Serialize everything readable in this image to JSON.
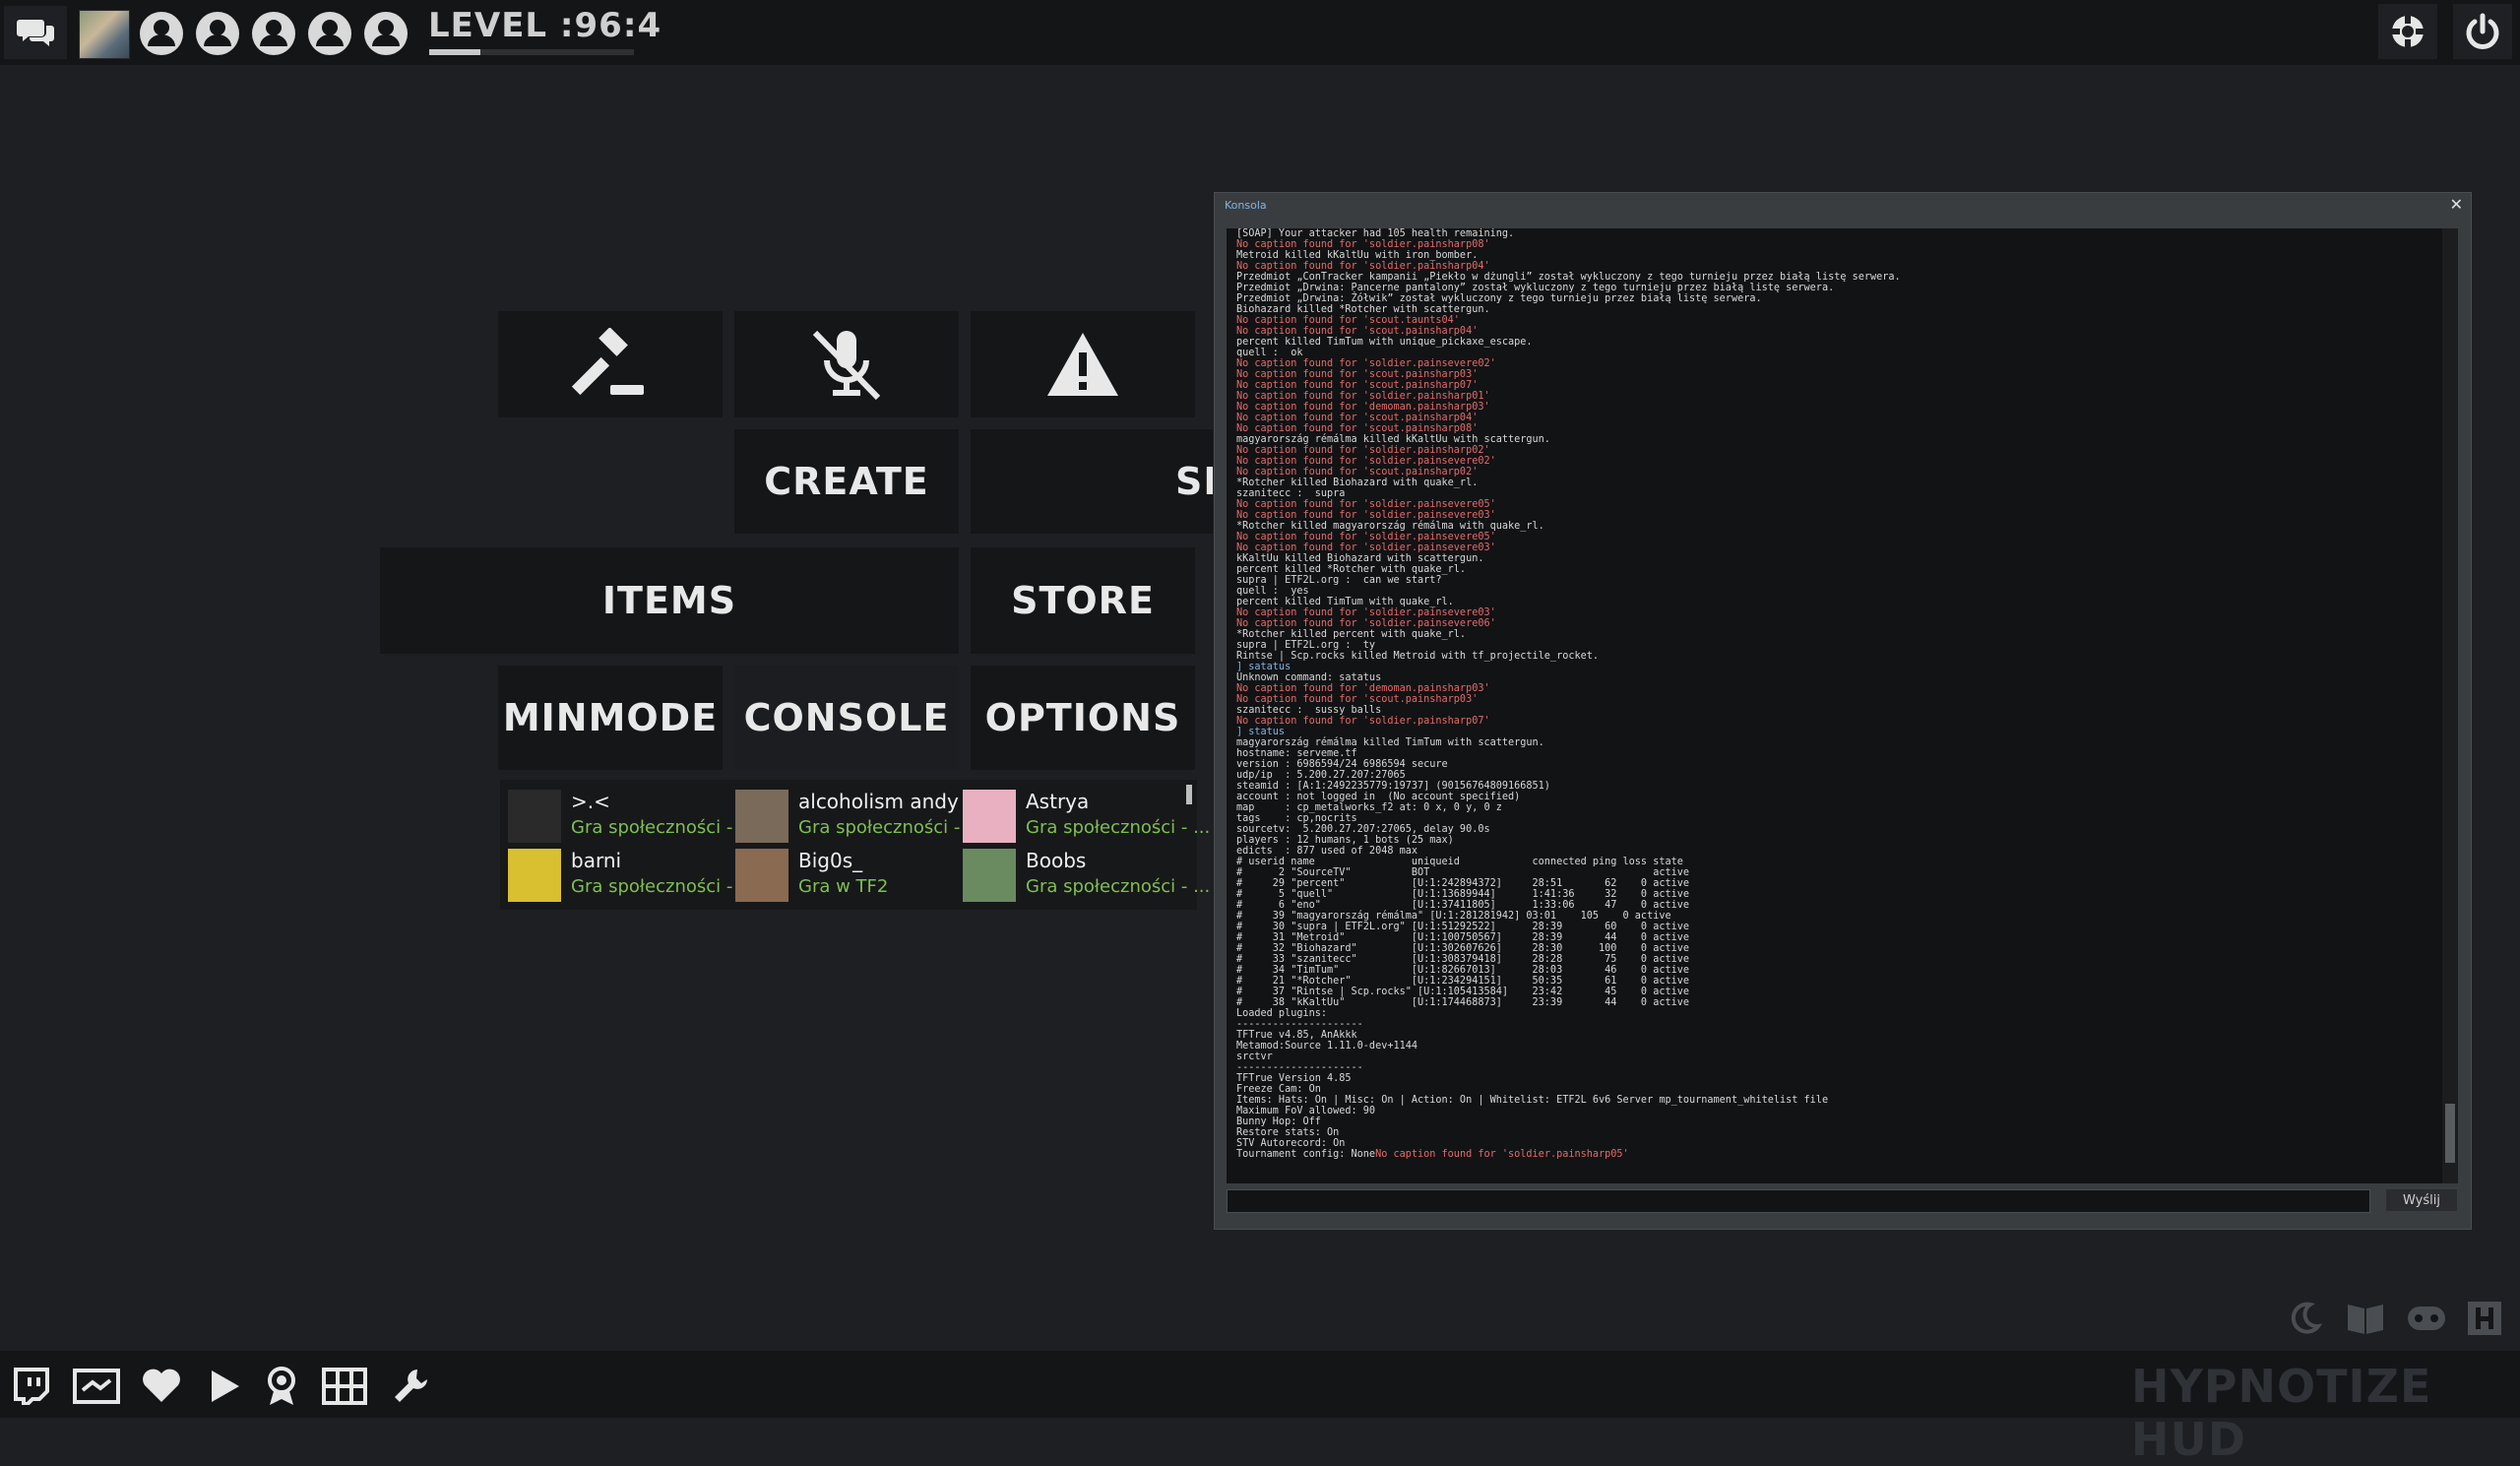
{
  "header": {
    "level_text": "LEVEL :96:4",
    "level_progress": 0.25,
    "party_slots": 5
  },
  "menu": {
    "create": "CREATE",
    "server_partial": "SE",
    "items": "ITEMS",
    "store": "STORE",
    "minmode": "MINMODE",
    "console": "CONSOLE",
    "options": "OPTIONS"
  },
  "friends": [
    {
      "name": ">.<",
      "status": "Gra społeczności - ...",
      "color": "#2a2a2a"
    },
    {
      "name": "alcoholism andy",
      "status": "Gra społeczności - ...",
      "color": "#7a6a5a"
    },
    {
      "name": "Astrya",
      "status": "Gra społeczności - ...",
      "color": "#e8b0c0"
    },
    {
      "name": "barni",
      "status": "Gra społeczności - ...",
      "color": "#d8c030"
    },
    {
      "name": "Big0s_",
      "status": "Gra w TF2",
      "color": "#8a6a50"
    },
    {
      "name": "Boobs",
      "status": "Gra społeczności - ...",
      "color": "#6a8a60"
    }
  ],
  "console": {
    "title": "Konsola",
    "send_label": "Wyślij",
    "lines": [
      {
        "t": "[SOAP] Your attacker had 105 health remaining.",
        "c": ""
      },
      {
        "t": "No caption found for 'soldier.painsharp08'",
        "c": "err"
      },
      {
        "t": "Metroid killed kKaltUu with iron_bomber.",
        "c": ""
      },
      {
        "t": "No caption found for 'soldier.painsharp04'",
        "c": "err"
      },
      {
        "t": "Przedmiot „ConTracker kampanii „Piekło w dżungli” został wykluczony z tego turnieju przez białą listę serwera.",
        "c": ""
      },
      {
        "t": "Przedmiot „Drwina: Pancerne pantalony” został wykluczony z tego turnieju przez białą listę serwera.",
        "c": ""
      },
      {
        "t": "Przedmiot „Drwina: Żółwik” został wykluczony z tego turnieju przez białą listę serwera.",
        "c": ""
      },
      {
        "t": "Biohazard killed *Rotcher with scattergun.",
        "c": ""
      },
      {
        "t": "No caption found for 'scout.taunts04'",
        "c": "err"
      },
      {
        "t": "No caption found for 'scout.painsharp04'",
        "c": "err"
      },
      {
        "t": "percent killed TimTum with unique_pickaxe_escape.",
        "c": ""
      },
      {
        "t": "quell :  ok",
        "c": ""
      },
      {
        "t": "No caption found for 'soldier.painsevere02'",
        "c": "err"
      },
      {
        "t": "No caption found for 'scout.painsharp03'",
        "c": "err"
      },
      {
        "t": "No caption found for 'scout.painsharp07'",
        "c": "err"
      },
      {
        "t": "No caption found for 'soldier.painsharp01'",
        "c": "err"
      },
      {
        "t": "No caption found for 'demoman.painsharp03'",
        "c": "err"
      },
      {
        "t": "No caption found for 'scout.painsharp04'",
        "c": "err"
      },
      {
        "t": "No caption found for 'scout.painsharp08'",
        "c": "err"
      },
      {
        "t": "magyarország rémálma killed kKaltUu with scattergun.",
        "c": ""
      },
      {
        "t": "No caption found for 'soldier.painsharp02'",
        "c": "err"
      },
      {
        "t": "No caption found for 'soldier.painsevere02'",
        "c": "err"
      },
      {
        "t": "No caption found for 'scout.painsharp02'",
        "c": "err"
      },
      {
        "t": "*Rotcher killed Biohazard with quake_rl.",
        "c": ""
      },
      {
        "t": "szanitecc :  supra",
        "c": ""
      },
      {
        "t": "No caption found for 'soldier.painsevere05'",
        "c": "err"
      },
      {
        "t": "No caption found for 'soldier.painsevere03'",
        "c": "err"
      },
      {
        "t": "*Rotcher killed magyarország rémálma with quake_rl.",
        "c": ""
      },
      {
        "t": "No caption found for 'soldier.painsevere05'",
        "c": "err"
      },
      {
        "t": "No caption found for 'soldier.painsevere03'",
        "c": "err"
      },
      {
        "t": "kKaltUu killed Biohazard with scattergun.",
        "c": ""
      },
      {
        "t": "percent killed *Rotcher with quake_rl.",
        "c": ""
      },
      {
        "t": "supra | ETF2L.org :  can we start?",
        "c": ""
      },
      {
        "t": "quell :  yes",
        "c": ""
      },
      {
        "t": "percent killed TimTum with quake_rl.",
        "c": ""
      },
      {
        "t": "No caption found for 'soldier.painsevere03'",
        "c": "err"
      },
      {
        "t": "No caption found for 'soldier.painsevere06'",
        "c": "err"
      },
      {
        "t": "*Rotcher killed percent with quake_rl.",
        "c": ""
      },
      {
        "t": "supra | ETF2L.org :  ty",
        "c": ""
      },
      {
        "t": "Rintse | Scp.rocks killed Metroid with tf_projectile_rocket.",
        "c": ""
      },
      {
        "t": "] satatus",
        "c": "cmd"
      },
      {
        "t": "Unknown command: satatus",
        "c": ""
      },
      {
        "t": "No caption found for 'demoman.painsharp03'",
        "c": "err"
      },
      {
        "t": "No caption found for 'scout.painsharp03'",
        "c": "err"
      },
      {
        "t": "szanitecc :  sussy balls",
        "c": ""
      },
      {
        "t": "No caption found for 'soldier.painsharp07'",
        "c": "err"
      },
      {
        "t": "] status",
        "c": "cmd"
      },
      {
        "t": "magyarország rémálma killed TimTum with scattergun.",
        "c": ""
      },
      {
        "t": "hostname: serveme.tf",
        "c": ""
      },
      {
        "t": "version : 6986594/24 6986594 secure",
        "c": ""
      },
      {
        "t": "udp/ip  : 5.200.27.207:27065",
        "c": ""
      },
      {
        "t": "steamid : [A:1:2492235779:19737] (90156764809166851)",
        "c": ""
      },
      {
        "t": "account : not logged in  (No account specified)",
        "c": ""
      },
      {
        "t": "map     : cp_metalworks_f2 at: 0 x, 0 y, 0 z",
        "c": ""
      },
      {
        "t": "tags    : cp,nocrits",
        "c": ""
      },
      {
        "t": "sourcetv:  5.200.27.207:27065, delay 90.0s",
        "c": ""
      },
      {
        "t": "players : 12 humans, 1 bots (25 max)",
        "c": ""
      },
      {
        "t": "edicts  : 877 used of 2048 max",
        "c": ""
      },
      {
        "t": "# userid name                uniqueid            connected ping loss state",
        "c": ""
      },
      {
        "t": "#      2 \"SourceTV\"          BOT                                     active",
        "c": ""
      },
      {
        "t": "#     29 \"percent\"           [U:1:242894372]     28:51       62    0 active",
        "c": ""
      },
      {
        "t": "#      5 \"quell\"             [U:1:13689944]      1:41:36     32    0 active",
        "c": ""
      },
      {
        "t": "#      6 \"eno\"               [U:1:37411805]      1:33:06     47    0 active",
        "c": ""
      },
      {
        "t": "#     39 \"magyarország rémálma\" [U:1:281281942] 03:01    105    0 active",
        "c": ""
      },
      {
        "t": "#     30 \"supra | ETF2L.org\" [U:1:51292522]      28:39       60    0 active",
        "c": ""
      },
      {
        "t": "#     31 \"Metroid\"           [U:1:100750567]     28:39       44    0 active",
        "c": ""
      },
      {
        "t": "#     32 \"Biohazard\"         [U:1:302607626]     28:30      100    0 active",
        "c": ""
      },
      {
        "t": "#     33 \"szanitecc\"         [U:1:308379418]     28:28       75    0 active",
        "c": ""
      },
      {
        "t": "#     34 \"TimTum\"            [U:1:82667013]      28:03       46    0 active",
        "c": ""
      },
      {
        "t": "#     21 \"*Rotcher\"          [U:1:234294151]     50:35       61    0 active",
        "c": ""
      },
      {
        "t": "#     37 \"Rintse | Scp.rocks\" [U:1:105413584]    23:42       45    0 active",
        "c": ""
      },
      {
        "t": "#     38 \"kKaltUu\"           [U:1:174468873]     23:39       44    0 active",
        "c": ""
      },
      {
        "t": "Loaded plugins:",
        "c": ""
      },
      {
        "t": "---------------------",
        "c": ""
      },
      {
        "t": "TFTrue v4.85, AnAkkk",
        "c": ""
      },
      {
        "t": "Metamod:Source 1.11.0-dev+1144",
        "c": ""
      },
      {
        "t": "srctvr",
        "c": ""
      },
      {
        "t": "---------------------",
        "c": ""
      },
      {
        "t": "TFTrue Version 4.85",
        "c": ""
      },
      {
        "t": "Freeze Cam: On",
        "c": ""
      },
      {
        "t": "Items: Hats: On | Misc: On | Action: On | Whitelist: ETF2L 6v6 Server mp_tournament_whitelist file",
        "c": ""
      },
      {
        "t": "Maximum FoV allowed: 90",
        "c": ""
      },
      {
        "t": "Bunny Hop: Off",
        "c": ""
      },
      {
        "t": "Restore stats: On",
        "c": ""
      },
      {
        "t": "STV Autorecord: On",
        "c": ""
      },
      {
        "t": "Tournament config: None|No caption found for 'soldier.painsharp05'",
        "c": "mixed"
      }
    ]
  },
  "footer": {
    "brand": "HYPNOTIZE HUD"
  }
}
